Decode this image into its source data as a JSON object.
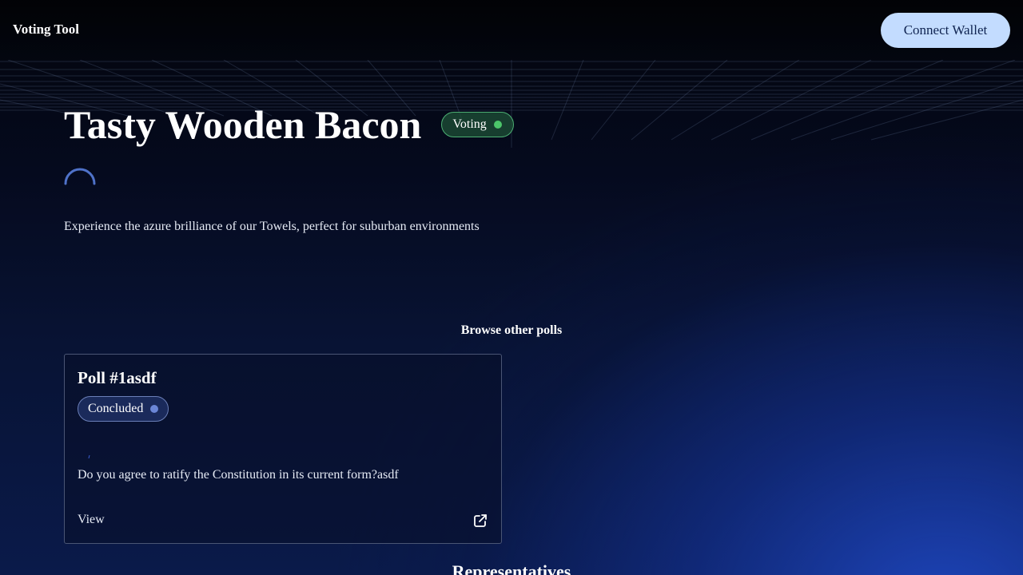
{
  "header": {
    "brand": "Voting Tool",
    "connect_label": "Connect Wallet"
  },
  "poll": {
    "title": "Tasty Wooden Bacon",
    "status": "Voting",
    "description": "Experience the azure brilliance of our Towels, perfect for suburban environments"
  },
  "browse": {
    "heading": "Browse other polls",
    "cards": [
      {
        "title": "Poll #1asdf",
        "status": "Concluded",
        "question": "Do you agree to ratify the Constitution in its current form?asdf",
        "view_label": "View"
      }
    ]
  },
  "representatives": {
    "heading": "Representatives"
  },
  "colors": {
    "accent": "#c3dcff",
    "voting_green": "#4cc56a",
    "concluded_blue": "#6b86d6"
  },
  "icons": {
    "external": "external-link-icon",
    "loading": "spinner-icon"
  }
}
